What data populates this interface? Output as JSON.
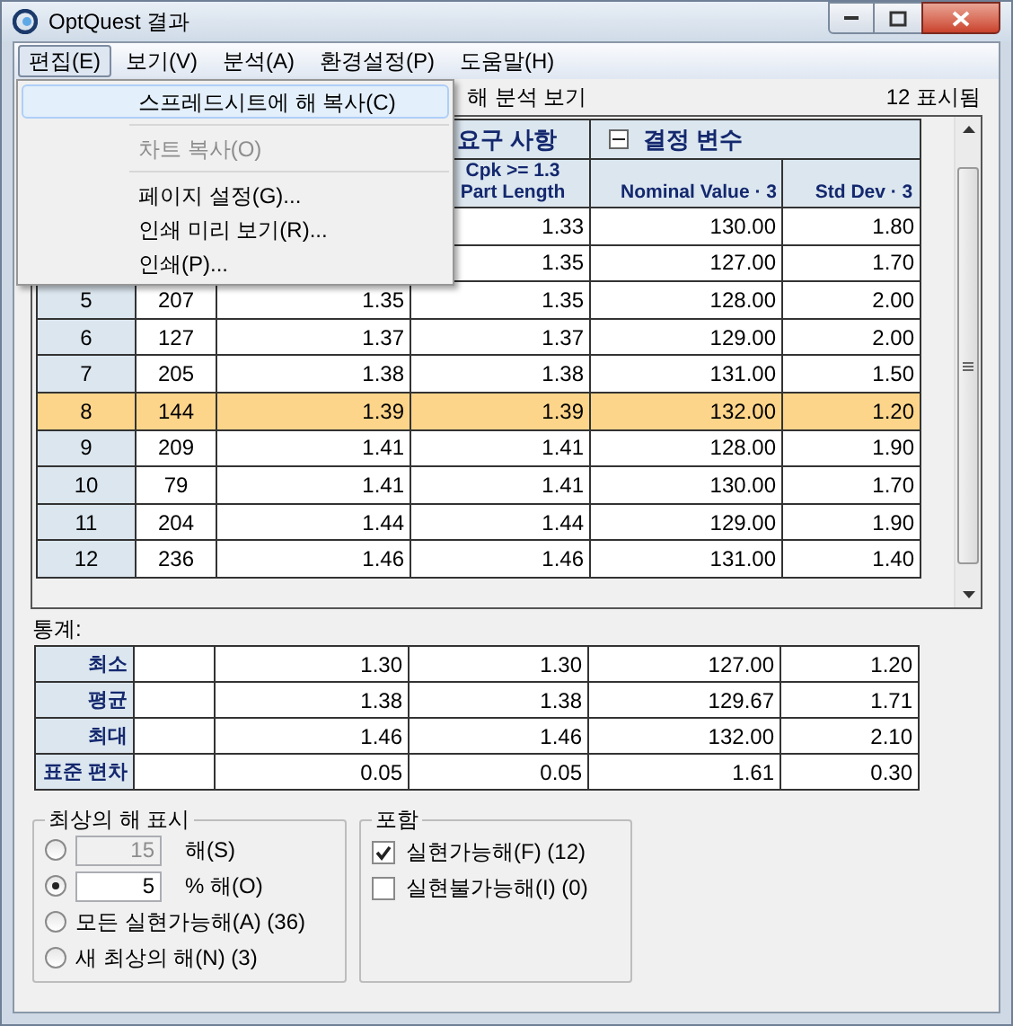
{
  "window": {
    "title": "OptQuest 결과"
  },
  "menu_bar": [
    {
      "label": "편집(E)",
      "selected": true
    },
    {
      "label": "보기(V)",
      "selected": false
    },
    {
      "label": "분석(A)",
      "selected": false
    },
    {
      "label": "환경설정(P)",
      "selected": false
    },
    {
      "label": "도움말(H)",
      "selected": false
    }
  ],
  "dropdown": [
    {
      "kind": "item",
      "label": "스프레드시트에 해 복사(C)",
      "selected": true,
      "disabled": false
    },
    {
      "kind": "separator"
    },
    {
      "kind": "item",
      "label": "차트 복사(O)",
      "selected": false,
      "disabled": true
    },
    {
      "kind": "separator"
    },
    {
      "kind": "item",
      "label": "페이지 설정(G)...",
      "selected": false,
      "disabled": false
    },
    {
      "kind": "item",
      "label": "인쇄 미리 보기(R)...",
      "selected": false,
      "disabled": false
    },
    {
      "kind": "item",
      "label": "인쇄(P)...",
      "selected": false,
      "disabled": false
    }
  ],
  "view_label": "해 분석 보기",
  "shown_count": "12 표시됨",
  "table": {
    "groups": [
      {
        "label": "요구 사항"
      },
      {
        "label": "결정 변수",
        "expanded": true
      }
    ],
    "columns": [
      "Cpk >= 1.3\nPart Length",
      "Nominal Value · 3",
      "Std Dev · 3"
    ],
    "rows": [
      {
        "part_length": "1.33",
        "nominal_value": "130.00",
        "std_dev": "1.80",
        "selected": false
      },
      {
        "part_length": "1.35",
        "nominal_value": "127.00",
        "std_dev": "1.70",
        "selected": false
      },
      {
        "number": "5",
        "column_2": "207",
        "column_3": "1.35",
        "part_length": "1.35",
        "nominal_value": "128.00",
        "std_dev": "2.00",
        "selected": false
      },
      {
        "number": "6",
        "column_2": "127",
        "column_3": "1.37",
        "part_length": "1.37",
        "nominal_value": "129.00",
        "std_dev": "2.00",
        "selected": false
      },
      {
        "number": "7",
        "column_2": "205",
        "column_3": "1.38",
        "part_length": "1.38",
        "nominal_value": "131.00",
        "std_dev": "1.50",
        "selected": false
      },
      {
        "number": "8",
        "column_2": "144",
        "column_3": "1.39",
        "part_length": "1.39",
        "nominal_value": "132.00",
        "std_dev": "1.20",
        "selected": true
      },
      {
        "number": "9",
        "column_2": "209",
        "column_3": "1.41",
        "part_length": "1.41",
        "nominal_value": "128.00",
        "std_dev": "1.90",
        "selected": false
      },
      {
        "number": "10",
        "column_2": "79",
        "column_3": "1.41",
        "part_length": "1.41",
        "nominal_value": "130.00",
        "std_dev": "1.70",
        "selected": false
      },
      {
        "number": "11",
        "column_2": "204",
        "column_3": "1.44",
        "part_length": "1.44",
        "nominal_value": "129.00",
        "std_dev": "1.90",
        "selected": false
      },
      {
        "number": "12",
        "column_2": "236",
        "column_3": "1.46",
        "part_length": "1.46",
        "nominal_value": "131.00",
        "std_dev": "1.40",
        "selected": false
      }
    ]
  },
  "statistics": {
    "label": "통계:",
    "rows": [
      {
        "name": "최소",
        "values": [
          "1.30",
          "1.30",
          "127.00",
          "1.20"
        ]
      },
      {
        "name": "평균",
        "values": [
          "1.38",
          "1.38",
          "129.67",
          "1.71"
        ]
      },
      {
        "name": "최대",
        "values": [
          "1.46",
          "1.46",
          "132.00",
          "2.10"
        ]
      },
      {
        "name": "표준 편차",
        "values": [
          "0.05",
          "0.05",
          "1.61",
          "0.30"
        ]
      }
    ]
  },
  "best_solutions": {
    "title": "최상의 해 표시",
    "options": [
      {
        "kind": "field",
        "value": "15",
        "label": "해(S)",
        "selected": false
      },
      {
        "kind": "field",
        "value": "5",
        "label": "% 해(O)",
        "selected": true
      },
      {
        "kind": "plain",
        "label": "모든 실현가능해(A)",
        "count": "(36)",
        "selected": false
      },
      {
        "kind": "plain",
        "label": "새 최상의 해(N)",
        "count": "(3)",
        "selected": false
      }
    ]
  },
  "include": {
    "title": "포함",
    "options": [
      {
        "label": "실현가능해(F)",
        "count": "(12)",
        "checked": true
      },
      {
        "label": "실현불가능해(I)",
        "count": "(0)",
        "checked": false
      }
    ]
  }
}
